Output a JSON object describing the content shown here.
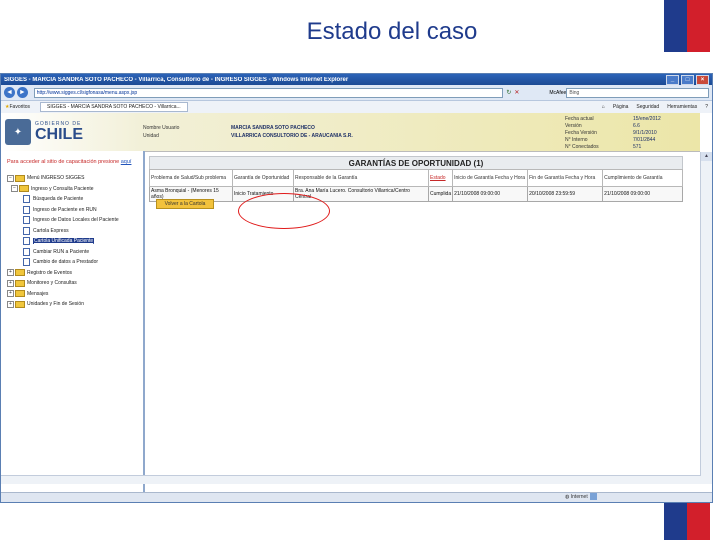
{
  "slide": {
    "title": "Estado del caso"
  },
  "browser": {
    "title": "SIGGES - MARCIA SANDRA SOTO PACHECO - Villarrica, Consultorio de - INGRESO SIGGES - Windows Internet Explorer",
    "url": "http://www.sigges.cl/sigfonasa/menu.aspx.jsp",
    "search_placeholder": "Bing",
    "mcafee_label": "McAfee",
    "favorites_label": "Favoritos",
    "tab_label": "SIGGES - MARCIA SANDRA SOTO PACHECO - Villarrica...",
    "toolbar_items": [
      "Página",
      "Seguridad",
      "Herramientas"
    ]
  },
  "header": {
    "logo_small": "GOBIERNO DE",
    "logo_big": "CHILE",
    "user_labels": [
      "Nombre Usuario",
      "Unidad"
    ],
    "user_name": "MARCIA SANDRA SOTO PACHECO",
    "unit_name": "VILLARRICA CONSULTORIO DE - ARAUCANIA S.R.",
    "sys_labels": [
      "Fecha actual",
      "Versión",
      "Fecha Versión",
      "N° Interno",
      "N° Conectados"
    ],
    "sys_values": [
      "15/ene/2012",
      "6.6",
      "9/1/1/2010",
      "7/01/2844",
      "571"
    ]
  },
  "sidebar": {
    "portal_text": "Para acceder al sitio de capacitación presione",
    "portal_link": "aquí",
    "menu_title": "Menú INGRESO SIGGES",
    "items": [
      "Ingreso y Consulta Paciente",
      "Búsqueda de Paciente",
      "Ingreso de Paciente en RUN",
      "Ingreso de Datos Locales del Paciente",
      "Cartola Express",
      "Cartola Unificada Paciente",
      "Cambiar RUN a Paciente",
      "Cambio de datos a Prestador",
      "Registro de Eventos",
      "Monitoreo y Consultas",
      "Mensajes",
      "Unidades y Fin de Sesión"
    ]
  },
  "main": {
    "panel_title": "GARANTÍAS DE OPORTUNIDAD (1)",
    "columns": [
      "Problema de Salud/Sub problema",
      "Garantía de Oportunidad",
      "Responsable de la Garantía",
      "Estado",
      "Inicio de Garantía Fecha y Hora",
      "Fin de Garantía Fecha y Hora",
      "Cumplimiento de Garantía"
    ],
    "row": [
      "Asma Bronquial - (Menores 15 años)",
      "Inicio Tratamiento",
      "Bra. Ana María Lucero. Consultorio Villarrica/Centro Central",
      "Cumplida",
      "21/10/2008 09:00:00",
      "20/10/2008 23:59:59",
      "21/10/2008 09:00:00"
    ],
    "back_button": "Volver a la Cartola"
  },
  "status": {
    "text": "Internet"
  }
}
